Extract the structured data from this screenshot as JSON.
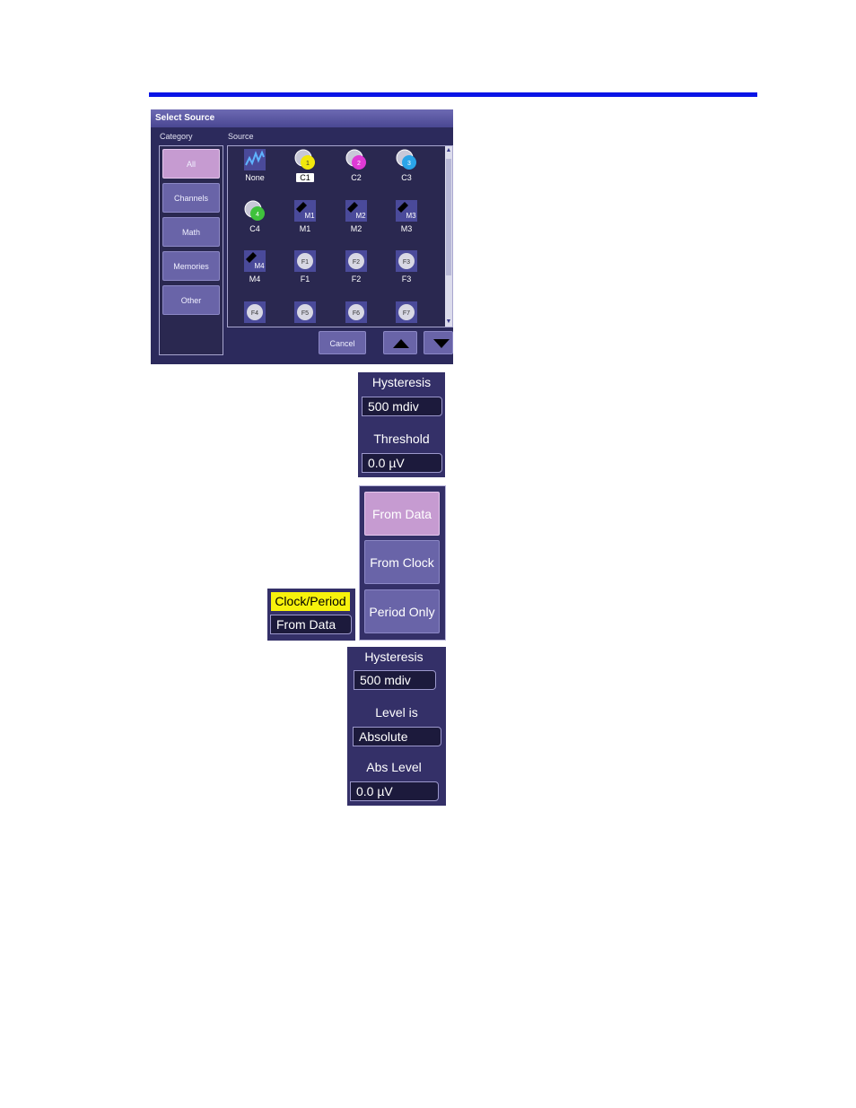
{
  "select_source": {
    "title": "Select Source",
    "category_label": "Category",
    "source_label": "Source",
    "categories": [
      "All",
      "Channels",
      "Math",
      "Memories",
      "Other"
    ],
    "sources": [
      "None",
      "C1",
      "C2",
      "C3",
      "C4",
      "M1",
      "M2",
      "M3",
      "M4",
      "F1",
      "F2",
      "F3",
      "F4",
      "F5",
      "F6",
      "F7"
    ],
    "selected_source": "C1",
    "cancel_label": "Cancel",
    "colors": {
      "C1": "#f2e80c",
      "C2": "#e03ad6",
      "C3": "#2aa4e8",
      "C4": "#3fc23c"
    }
  },
  "hysteresis_panel_1": {
    "hysteresis_label": "Hysteresis",
    "hysteresis_value": "500 mdiv",
    "threshold_label": "Threshold",
    "threshold_value": "0.0 µV"
  },
  "mode_panel": {
    "buttons": [
      "From Data",
      "From Clock",
      "Period Only"
    ],
    "active": "From Data"
  },
  "clock_period": {
    "label": "Clock/Period",
    "value": "From Data"
  },
  "hysteresis_panel_2": {
    "hysteresis_label": "Hysteresis",
    "hysteresis_value": "500 mdiv",
    "level_is_label": "Level is",
    "level_is_value": "Absolute",
    "abs_level_label": "Abs Level",
    "abs_level_value": "0.0 µV"
  }
}
